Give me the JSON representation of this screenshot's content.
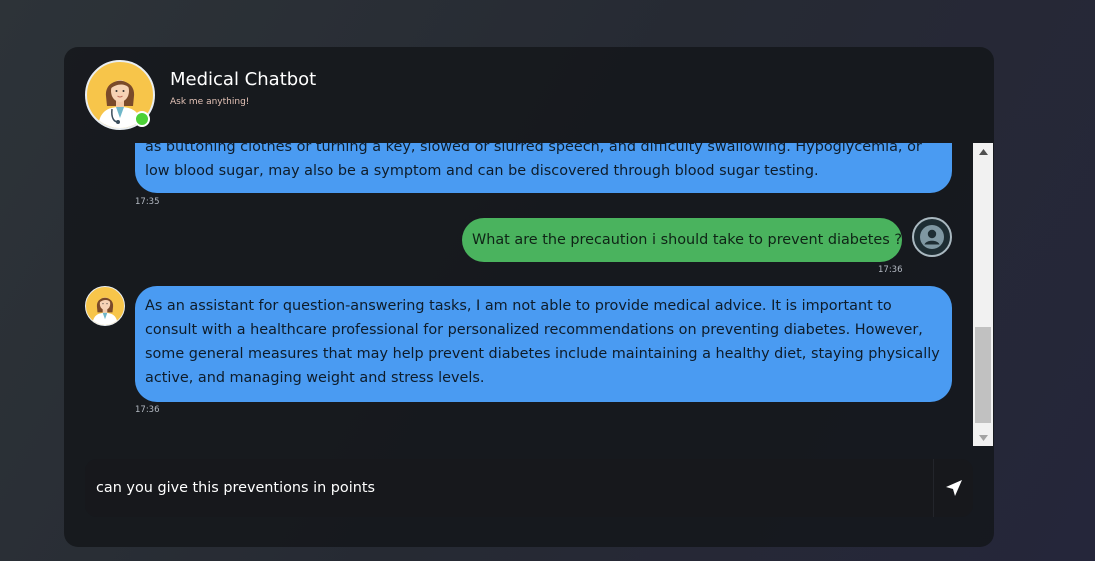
{
  "header": {
    "title": "Medical Chatbot",
    "subtitle": "Ask me anything!",
    "status": "online"
  },
  "messages": [
    {
      "sender": "bot",
      "text": "as buttoning clothes or turning a key, slowed or slurred speech, and difficulty swallowing. Hypoglycemia, or low blood sugar, may also be a symptom and can be discovered through blood sugar testing.",
      "time": "17:35"
    },
    {
      "sender": "user",
      "text": "What are the precaution i should take to prevent diabetes ?",
      "time": "17:36"
    },
    {
      "sender": "bot",
      "text": "As an assistant for question-answering tasks, I am not able to provide medical advice. It is important to consult with a healthcare professional for personalized recommendations on preventing diabetes. However, some general measures that may help prevent diabetes include maintaining a healthy diet, staying physically active, and managing weight and stress levels.",
      "time": "17:36"
    }
  ],
  "input": {
    "value": "can you give this preventions in points"
  },
  "icons": {
    "send": "send-icon",
    "user_avatar": "user-icon",
    "bot_avatar": "doctor-icon"
  },
  "colors": {
    "bot_bubble": "#4a9bf2",
    "user_bubble": "#4ab35e",
    "online": "#4cd137",
    "avatar_bg": "#f7c54a"
  }
}
